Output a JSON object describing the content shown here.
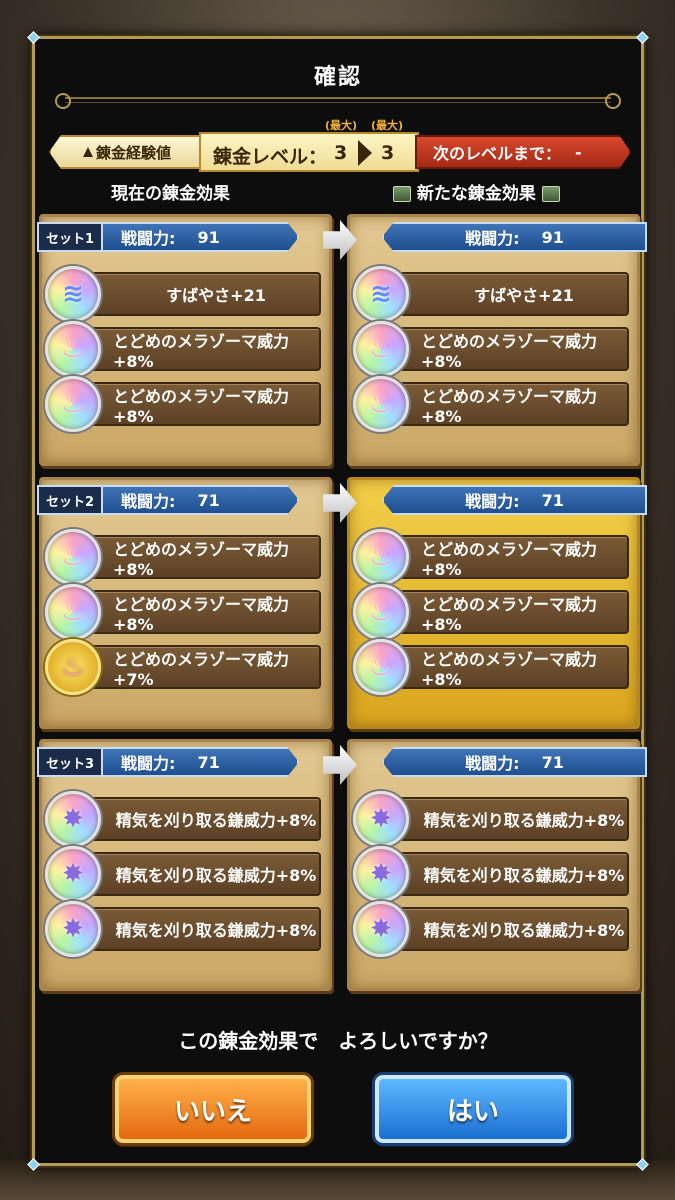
{
  "dialog": {
    "title": "確認",
    "question": "この錬金効果で　よろしいですか？",
    "no_label": "いいえ",
    "yes_label": "はい"
  },
  "level_bar": {
    "exp_label": "錬金経験値",
    "level_label": "錬金レベル：",
    "current_level": "3",
    "next_level": "3",
    "max_tag": "(最大)",
    "next_label": "次のレベルまで：",
    "next_value": "-"
  },
  "columns": {
    "current_title": "現在の錬金効果",
    "new_title": "新たな錬金効果"
  },
  "power_label": "戦闘力:",
  "sets": [
    {
      "name": "セット1",
      "current": {
        "power": "91",
        "effects": [
          "すばやさ+21",
          "とどめのメラゾーマ威力+8%",
          "とどめのメラゾーマ威力+8%"
        ],
        "icons": [
          "wing-icon",
          "flame-icon",
          "flame-icon"
        ]
      },
      "new": {
        "power": "91",
        "effects": [
          "すばやさ+21",
          "とどめのメラゾーマ威力+8%",
          "とどめのメラゾーマ威力+8%"
        ],
        "icons": [
          "wing-icon",
          "flame-icon",
          "flame-icon"
        ],
        "highlighted": false
      }
    },
    {
      "name": "セット2",
      "current": {
        "power": "71",
        "effects": [
          "とどめのメラゾーマ威力+8%",
          "とどめのメラゾーマ威力+8%",
          "とどめのメラゾーマ威力+7%"
        ],
        "icons": [
          "flame-icon",
          "flame-icon",
          "flame-gold-icon"
        ]
      },
      "new": {
        "power": "71",
        "effects": [
          "とどめのメラゾーマ威力+8%",
          "とどめのメラゾーマ威力+8%",
          "とどめのメラゾーマ威力+8%"
        ],
        "icons": [
          "flame-icon",
          "flame-icon",
          "flame-icon"
        ],
        "highlighted": true
      }
    },
    {
      "name": "セット3",
      "current": {
        "power": "71",
        "effects": [
          "精気を刈り取る鎌威力+8%",
          "精気を刈り取る鎌威力+8%",
          "精気を刈り取る鎌威力+8%"
        ],
        "icons": [
          "star-icon",
          "star-icon",
          "star-icon"
        ]
      },
      "new": {
        "power": "71",
        "effects": [
          "精気を刈り取る鎌威力+8%",
          "精気を刈り取る鎌威力+8%",
          "精気を刈り取る鎌威力+8%"
        ],
        "icons": [
          "star-icon",
          "star-icon",
          "star-icon"
        ],
        "highlighted": false
      }
    }
  ]
}
